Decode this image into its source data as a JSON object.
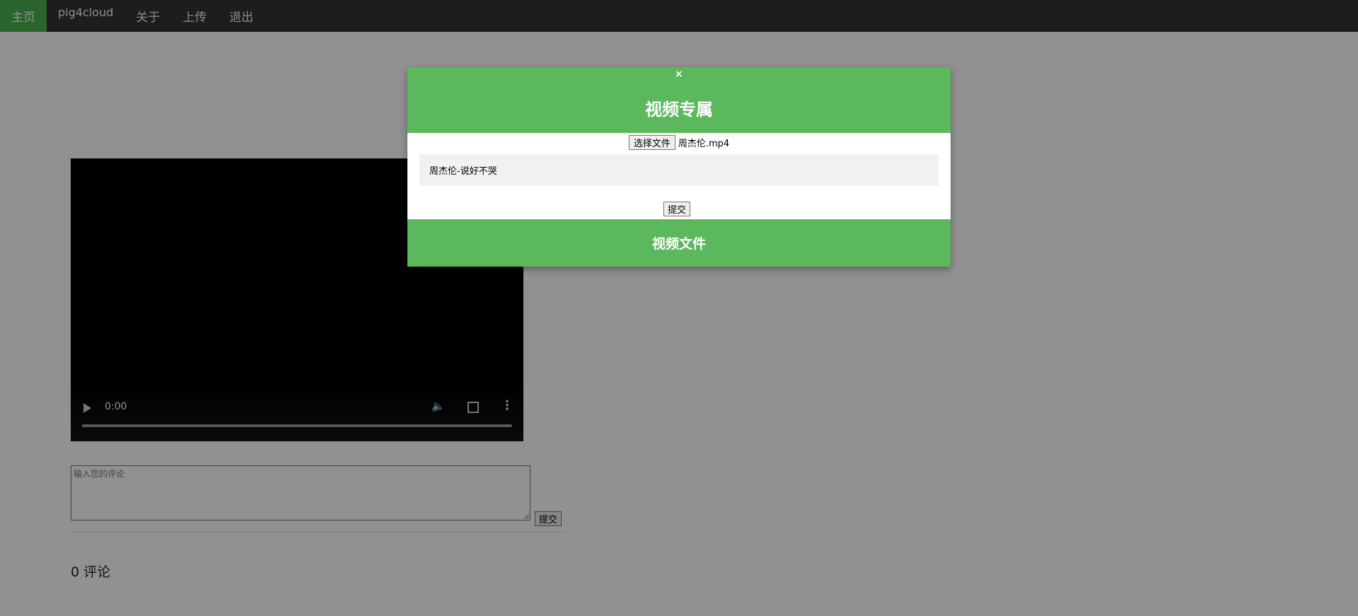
{
  "nav": {
    "items": [
      {
        "label": "主页",
        "active": true
      },
      {
        "label": "pig4cloud",
        "active": false
      },
      {
        "label": "关于",
        "active": false
      },
      {
        "label": "上传",
        "active": false
      },
      {
        "label": "退出",
        "active": false
      }
    ]
  },
  "video": {
    "time": "0:00"
  },
  "comments": {
    "placeholder": "输入您的评论",
    "submit_label": "提交",
    "count_text": "0 评论"
  },
  "modal": {
    "close_label": "×",
    "title": "视频专属",
    "file_button_label": "选择文件",
    "file_name": "周杰伦.mp4",
    "title_input_value": "周杰伦-说好不哭",
    "submit_label": "提交",
    "footer_text": "视频文件"
  },
  "colors": {
    "nav_bg": "#333333",
    "nav_active": "#4CAF50",
    "modal_accent": "#5cb85c",
    "overlay": "rgba(0,0,0,0.43)"
  },
  "icons": {
    "play": "play-icon",
    "volume": "volume-icon",
    "fullscreen": "fullscreen-icon",
    "more": "more-vertical-icon",
    "close": "close-icon"
  }
}
